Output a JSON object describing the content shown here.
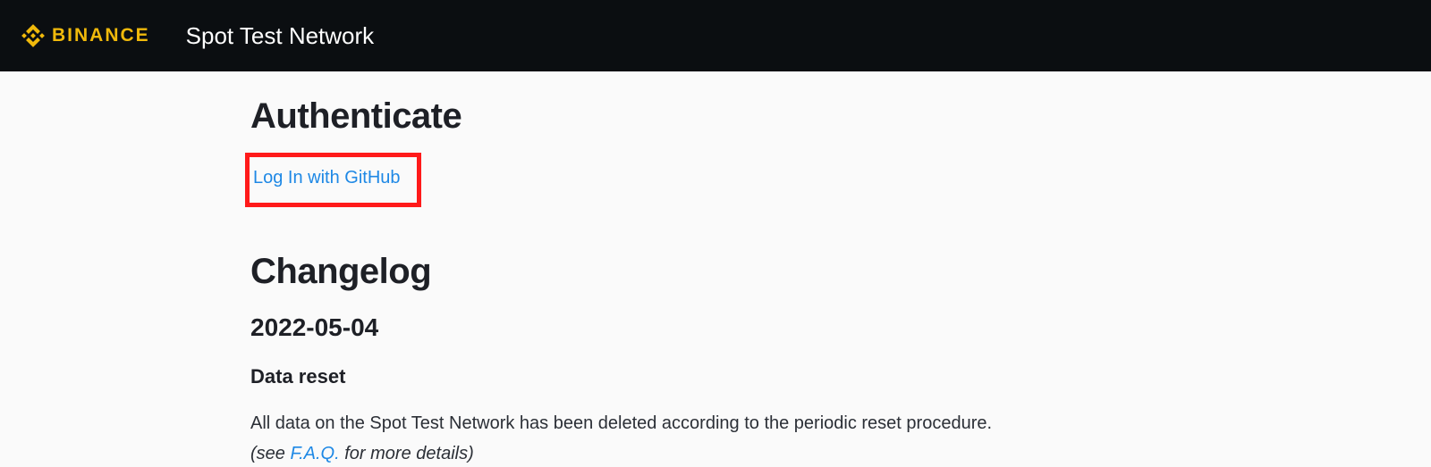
{
  "header": {
    "brand": "BINANCE",
    "title": "Spot Test Network"
  },
  "auth": {
    "heading": "Authenticate",
    "login_label": "Log In with GitHub"
  },
  "changelog": {
    "heading": "Changelog",
    "date": "2022-05-04",
    "subheading": "Data reset",
    "body": "All data on the Spot Test Network has been deleted according to the periodic reset procedure.",
    "see_prefix": "(see ",
    "faq_label": "F.A.Q.",
    "see_suffix": " for more details)"
  }
}
